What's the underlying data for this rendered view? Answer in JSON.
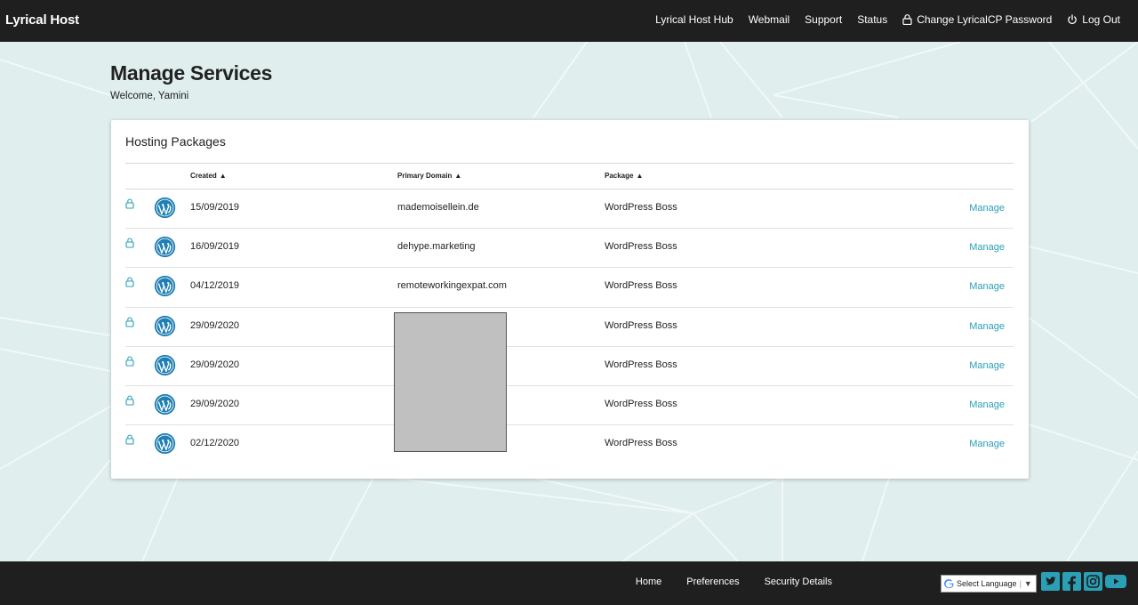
{
  "brand": "Lyrical Host",
  "nav": {
    "hub": "Lyrical Host Hub",
    "webmail": "Webmail",
    "support": "Support",
    "status": "Status",
    "change_password": "Change LyricalCP Password",
    "logout": "Log Out"
  },
  "page": {
    "title": "Manage Services",
    "welcome": "Welcome, Yamini"
  },
  "card": {
    "title": "Hosting Packages",
    "columns": {
      "created": "Created",
      "domain": "Primary Domain",
      "package": "Package"
    },
    "rows": [
      {
        "created": "15/09/2019",
        "domain": "mademoisellein.de",
        "package": "WordPress Boss",
        "action": "Manage"
      },
      {
        "created": "16/09/2019",
        "domain": "dehype.marketing",
        "package": "WordPress Boss",
        "action": "Manage"
      },
      {
        "created": "04/12/2019",
        "domain": "remoteworkingexpat.com",
        "package": "WordPress Boss",
        "action": "Manage"
      },
      {
        "created": "29/09/2020",
        "domain": "",
        "package": "WordPress Boss",
        "action": "Manage"
      },
      {
        "created": "29/09/2020",
        "domain": "",
        "package": "WordPress Boss",
        "action": "Manage"
      },
      {
        "created": "29/09/2020",
        "domain": "",
        "package": "WordPress Boss",
        "action": "Manage"
      },
      {
        "created": "02/12/2020",
        "domain": "",
        "package": "WordPress Boss",
        "action": "Manage"
      }
    ]
  },
  "footer": {
    "home": "Home",
    "preferences": "Preferences",
    "security": "Security Details",
    "language": "Select Language"
  },
  "icons": {
    "lock": "lock-icon",
    "wordpress": "wordpress-icon",
    "power": "power-icon",
    "google": "google-icon",
    "twitter": "twitter-icon",
    "facebook": "facebook-icon",
    "instagram": "instagram-icon",
    "youtube": "youtube-icon"
  },
  "colors": {
    "accent": "#2a9fb5",
    "wordpress": "#1e7fb5",
    "dark": "#1f1f1f",
    "background": "#e0eeee"
  }
}
